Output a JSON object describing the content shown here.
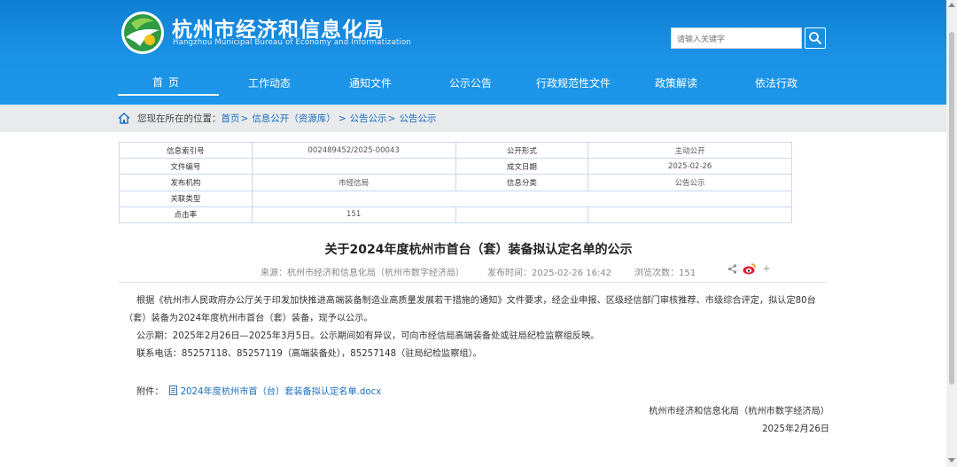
{
  "site": {
    "title": "杭州市经济和信息化局",
    "subtitle": "Hangzhou Municipal Bureau of Economy and Informatization",
    "logo_icon": "city-emblem-icon"
  },
  "search": {
    "placeholder": "请输入关键字",
    "icon": "search-icon"
  },
  "nav": {
    "items": [
      "首页",
      "工作动态",
      "通知文件",
      "公示公告",
      "行政规范性文件",
      "政策解读",
      "依法行政"
    ],
    "active_index": 0
  },
  "breadcrumb": {
    "prefix": "您现在所在的位置：",
    "links": [
      "首页",
      "信息公开（资源库）",
      "公告公示",
      "公告公示"
    ],
    "separators": [
      ">",
      ">",
      ">"
    ]
  },
  "info_table": {
    "rows": [
      [
        "信息索引号",
        "002489452/2025-00043",
        "公开形式",
        "主动公开"
      ],
      [
        "文件编号",
        "",
        "成文日期",
        "2025-02-26"
      ],
      [
        "发布机构",
        "市经信局",
        "信息分类",
        "公告公示"
      ],
      [
        "关联类型",
        "",
        "",
        ""
      ],
      [
        "点击率",
        "151",
        "",
        ""
      ]
    ]
  },
  "article": {
    "title": "关于2024年度杭州市首台（套）装备拟认定名单的公示",
    "source_label": "来源：杭州市经济和信息化局（杭州市数字经济局）",
    "publish_label": "发布时间：2025-02-26 16:42",
    "views_label": "浏览次数：151",
    "paragraphs": [
      "根据《杭州市人民政府办公厅关于印发加快推进高端装备制造业高质量发展若干措施的通知》文件要求，经企业申报、区级经信部门审核推荐、市级综合评定，拟认定80台（套）装备为2024年度杭州市首台（套）装备，现予以公示。",
      "公示期：2025年2月26日—2025年3月5日。公示期间如有异议，可向市经信局高端装备处或驻局纪检监察组反映。",
      "联系电话：85257118、85257119（高端装备处），85257148（驻局纪检监察组）。"
    ],
    "attachment_label": "附件：",
    "attachment_name": "2024年度杭州市首（台）套装备拟认定名单.docx",
    "signature": "杭州市经济和信息化局（杭州市数字经济局）",
    "date": "2025年2月26日"
  },
  "colors": {
    "header_blue": "#1a92e6",
    "link_blue": "#1a6fc0",
    "weibo_red": "#e6162d"
  }
}
